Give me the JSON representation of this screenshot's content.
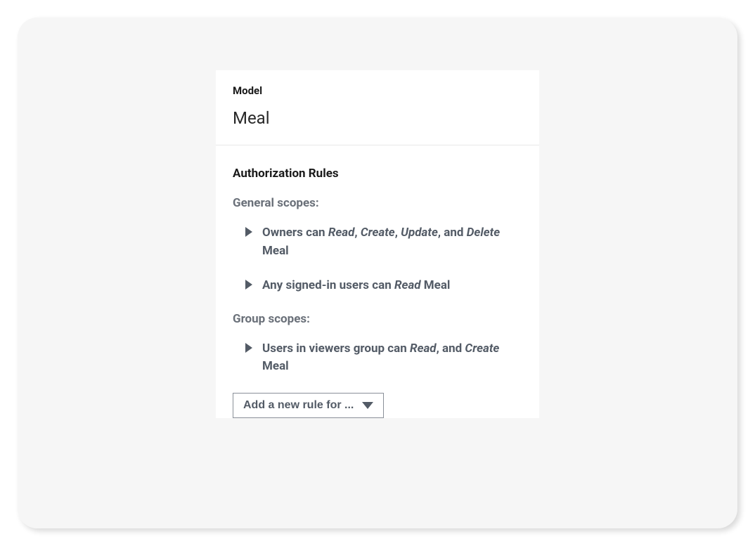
{
  "model": {
    "label": "Model",
    "name": "Meal"
  },
  "auth": {
    "section_title": "Authorization Rules",
    "general_label": "General scopes:",
    "group_label": "Group scopes:",
    "rules": {
      "owners": {
        "prefix": "Owners can ",
        "perm1": "Read",
        "sep1": ", ",
        "perm2": "Create",
        "sep2": ", ",
        "perm3": "Update",
        "sep3": ", and ",
        "perm4": "Delete",
        "suffix": " Meal"
      },
      "signed_in": {
        "prefix": "Any signed-in users can ",
        "perm1": "Read",
        "suffix": " Meal"
      },
      "viewers_group": {
        "prefix": "Users in viewers group can ",
        "perm1": "Read",
        "sep1": ", and ",
        "perm2": "Create",
        "suffix": " Meal"
      }
    },
    "add_button_label": "Add a new rule for ..."
  }
}
